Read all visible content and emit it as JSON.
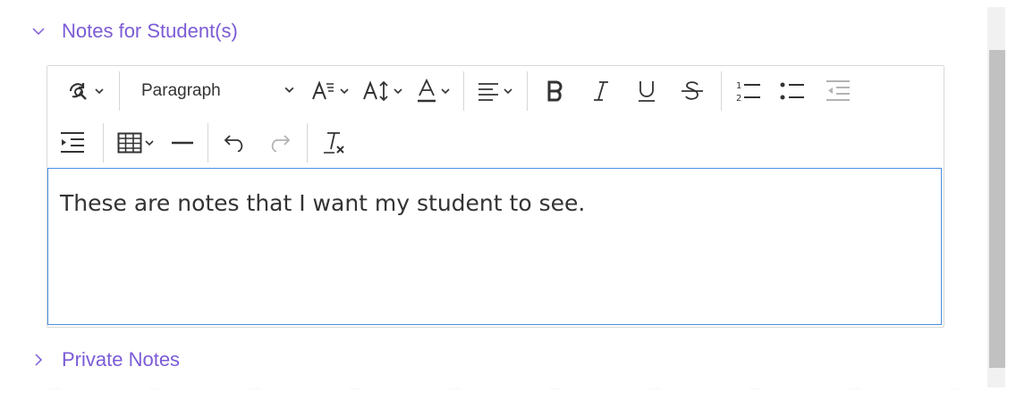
{
  "sections": {
    "notes_for_student": {
      "label": "Notes for Student(s)",
      "expanded": true
    },
    "private_notes": {
      "label": "Private Notes",
      "expanded": false
    }
  },
  "toolbar": {
    "find_replace_icon": "find-replace-icon",
    "heading_select": {
      "value": "Paragraph"
    },
    "buttons": [
      "font-size-icon",
      "line-height-icon",
      "font-color-icon",
      "align-icon",
      "bold-icon",
      "italic-icon",
      "underline-icon",
      "strikethrough-icon",
      "numbered-list-icon",
      "bullet-list-icon",
      "outdent-icon",
      "indent-icon",
      "table-icon",
      "horizontal-line-icon",
      "undo-icon",
      "redo-icon",
      "clear-formatting-icon"
    ],
    "redo_disabled": true,
    "outdent_disabled": true
  },
  "editor": {
    "content": "These are notes that I want my student to see."
  },
  "colors": {
    "accent": "#7b5bd6",
    "focus_border": "#4a90e2",
    "text": "#333333"
  }
}
